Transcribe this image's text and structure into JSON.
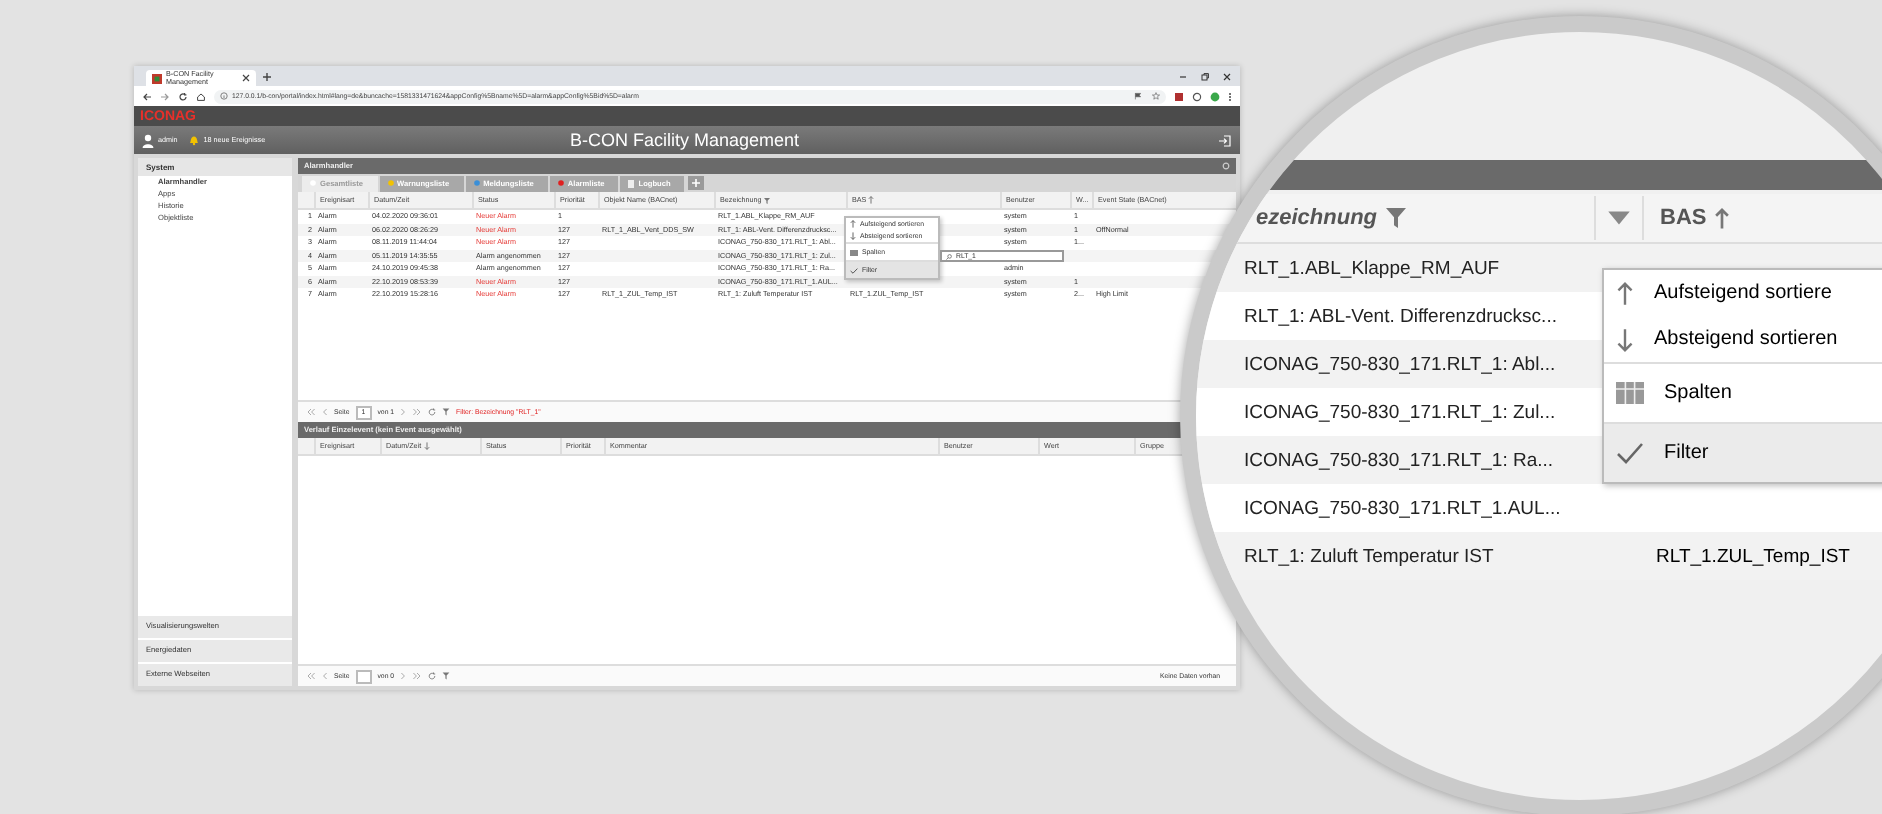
{
  "browser": {
    "tab_title": "B-CON Facility Management",
    "url": "127.0.0.1/b-con/portal/index.html#lang=de&buncache=1581331471624&appConfig%5Bname%5D=alarm&appConfig%5Bid%5D=alarm"
  },
  "app": {
    "logo": "ICONAG",
    "user": "admin",
    "notifications": "18 neue Ereignisse",
    "title": "B-CON Facility Management"
  },
  "sidebar": {
    "header": "System",
    "items": [
      {
        "label": "Alarmhandler",
        "selected": true
      },
      {
        "label": "Apps",
        "selected": false
      },
      {
        "label": "Historie",
        "selected": false
      },
      {
        "label": "Objektliste",
        "selected": false
      }
    ],
    "sections": [
      "Visualisierungswelten",
      "Energiedaten",
      "Externe Webseiten"
    ]
  },
  "panel": {
    "title": "Alarmhandler",
    "tabs": [
      {
        "label": "Gesamtliste",
        "kind": "dot",
        "color": "#ffffff",
        "selected": true
      },
      {
        "label": "Warnungsliste",
        "kind": "dot",
        "color": "#f2c200",
        "selected": false
      },
      {
        "label": "Meldungsliste",
        "kind": "dot",
        "color": "#3a8fd8",
        "selected": false
      },
      {
        "label": "Alarmliste",
        "kind": "dot",
        "color": "#e02020",
        "selected": false
      },
      {
        "label": "Logbuch",
        "kind": "log",
        "selected": false
      }
    ]
  },
  "table": {
    "columns": [
      {
        "label": "Ereignisart"
      },
      {
        "label": "Datum/Zeit"
      },
      {
        "label": "Status"
      },
      {
        "label": "Priorität"
      },
      {
        "label": "Objekt Name (BACnet)"
      },
      {
        "label": "Bezeichnung",
        "filtered": true
      },
      {
        "label": "BAS",
        "sorted_ascending": true
      },
      {
        "label": "Benutzer"
      },
      {
        "label": "W..."
      },
      {
        "label": "Event State (BACnet)"
      }
    ],
    "rows": [
      {
        "n": "1",
        "type": "Alarm",
        "datetime": "04.02.2020 09:36:01",
        "status": "Neuer Alarm",
        "acknowledged": false,
        "priority": "1",
        "description": "RLT_1.ABL_Klappe_RM_AUF",
        "user": "system",
        "w": "1"
      },
      {
        "n": "2",
        "type": "Alarm",
        "datetime": "06.02.2020 08:26:29",
        "status": "Neuer Alarm",
        "acknowledged": false,
        "priority": "127",
        "object_name": "RLT_1_ABL_Vent_DDS_SW",
        "description": "RLT_1: ABL-Vent. Differenzdrucksc...",
        "user": "system",
        "w": "1",
        "event_state": "OffNormal"
      },
      {
        "n": "3",
        "type": "Alarm",
        "datetime": "08.11.2019 11:44:04",
        "status": "Neuer Alarm",
        "acknowledged": false,
        "priority": "127",
        "description": "ICONAG_750-830_171.RLT_1: Abl...",
        "user": "system",
        "w": "1..."
      },
      {
        "n": "4",
        "type": "Alarm",
        "datetime": "05.11.2019 14:35:55",
        "status": "Alarm angenommen",
        "acknowledged": true,
        "priority": "127",
        "description": "ICONAG_750-830_171.RLT_1: Zul..."
      },
      {
        "n": "5",
        "type": "Alarm",
        "datetime": "24.10.2019 09:45:38",
        "status": "Alarm angenommen",
        "acknowledged": true,
        "priority": "127",
        "description": "ICONAG_750-830_171.RLT_1: Ra...",
        "user": "admin"
      },
      {
        "n": "6",
        "type": "Alarm",
        "datetime": "22.10.2019 08:53:39",
        "status": "Neuer Alarm",
        "acknowledged": false,
        "priority": "127",
        "description": "ICONAG_750-830_171.RLT_1.AUL...",
        "user": "system",
        "w": "1"
      },
      {
        "n": "7",
        "type": "Alarm",
        "datetime": "22.10.2019 15:28:16",
        "status": "Neuer Alarm",
        "acknowledged": false,
        "priority": "127",
        "object_name": "RLT_1_ZUL_Temp_IST",
        "description": "RLT_1: Zuluft Temperatur IST",
        "bas": "RLT_1.ZUL_Temp_IST",
        "user": "system",
        "w": "2...",
        "event_state": "High Limit"
      }
    ]
  },
  "column_menu": {
    "items": [
      {
        "label": "Aufsteigend sortieren",
        "kind": "sort-asc",
        "checked": false
      },
      {
        "label": "Absteigend sortieren",
        "kind": "sort-desc",
        "checked": false
      },
      {
        "label": "Spalten",
        "kind": "columns",
        "checked": false
      },
      {
        "label": "Filter",
        "kind": "filter",
        "checked": true
      }
    ],
    "filter_value": "RLT_1"
  },
  "pager": {
    "page_label": "Seite",
    "page": "1",
    "of": "von 1",
    "filter": "Filter: Bezeichnung \"RLT_1\""
  },
  "detail": {
    "title": "Verlauf Einzelevent (kein Event ausgewählt)",
    "columns": [
      {
        "label": "Ereignisart"
      },
      {
        "label": "Datum/Zeit",
        "sorted_descending": true
      },
      {
        "label": "Status"
      },
      {
        "label": "Priorität"
      },
      {
        "label": "Kommentar"
      },
      {
        "label": "Benutzer"
      },
      {
        "label": "Wert"
      },
      {
        "label": "Gruppe"
      }
    ],
    "pager": {
      "page_label": "Seite",
      "of": "von 0",
      "status": "Keine Daten vorhan"
    }
  },
  "magnifier": {
    "columns": [
      {
        "label": "ezeichnung",
        "filtered": true
      },
      {
        "label": "BAS",
        "sorted_ascending": true
      }
    ],
    "rows": [
      {
        "description": "RLT_1.ABL_Klappe_RM_AUF"
      },
      {
        "description": "RLT_1: ABL-Vent. Differenzdrucksc..."
      },
      {
        "description": "ICONAG_750-830_171.RLT_1: Abl..."
      },
      {
        "description": "ICONAG_750-830_171.RLT_1: Zul..."
      },
      {
        "description": "ICONAG_750-830_171.RLT_1: Ra..."
      },
      {
        "description": "ICONAG_750-830_171.RLT_1.AUL..."
      },
      {
        "description": "RLT_1: Zuluft Temperatur IST",
        "bas": "RLT_1.ZUL_Temp_IST"
      }
    ],
    "menu": [
      {
        "label": "Aufsteigend sortiere",
        "kind": "sort-asc",
        "checked": false
      },
      {
        "label": "Absteigend sortieren",
        "kind": "sort-desc",
        "checked": false
      },
      {
        "label": "Spalten",
        "kind": "columns",
        "checked": false
      },
      {
        "label": "Filter",
        "kind": "filter",
        "checked": true
      }
    ]
  }
}
